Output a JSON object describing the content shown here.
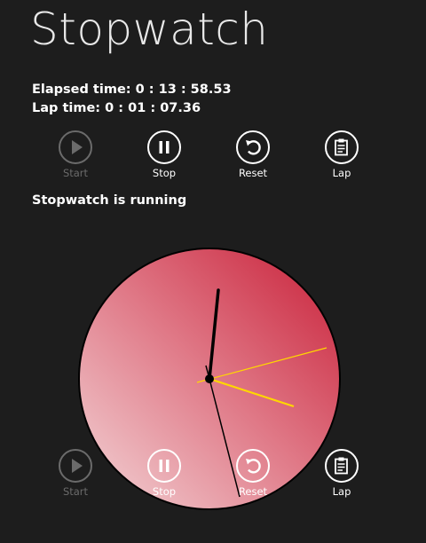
{
  "app": {
    "title": "Stopwatch"
  },
  "elapsed": {
    "label": "Elapsed time: ",
    "value": "0 : 13 : 58.53"
  },
  "lap": {
    "label": "Lap time: ",
    "value": "0 : 01 : 07.36"
  },
  "status": "Stopwatch is running",
  "buttons": [
    {
      "label": "Start",
      "icon": "play-icon",
      "enabled": false
    },
    {
      "label": "Stop",
      "icon": "pause-icon",
      "enabled": true
    },
    {
      "label": "Reset",
      "icon": "reset-icon",
      "enabled": true
    },
    {
      "label": "Lap",
      "icon": "clipboard-icon",
      "enabled": true
    }
  ],
  "overlay_buttons": [
    {
      "label": "Start",
      "icon": "play-icon",
      "enabled": false
    },
    {
      "label": "Stop",
      "icon": "pause-icon",
      "enabled": true
    },
    {
      "label": "Reset",
      "icon": "reset-icon",
      "enabled": true
    },
    {
      "label": "Lap",
      "icon": "clipboard-icon",
      "enabled": true
    }
  ],
  "colors": {
    "background": "#1d1d1d",
    "clock_face_light": "#f0cdd0",
    "clock_face_dark": "#cc2a40",
    "hand_black": "#000000",
    "hand_yellow": "#ffd700",
    "disabled": "#6b6b6b"
  }
}
